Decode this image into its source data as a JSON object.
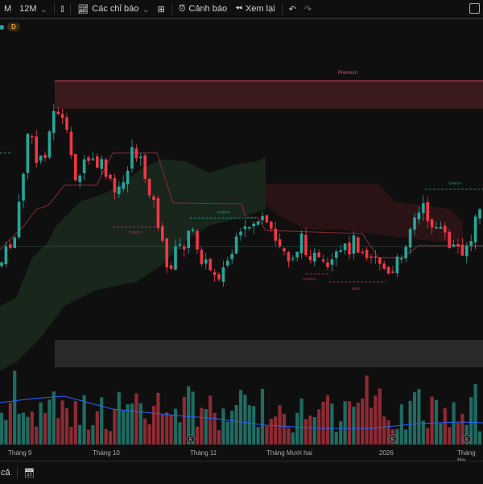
{
  "toolbar": {
    "interval_prev": "M",
    "interval": "12M",
    "indicators_label": "Các chỉ báo",
    "alerts_label": "Cảnh báo",
    "replay_label": "Xem lại"
  },
  "status": {
    "badge": "D"
  },
  "chart": {
    "premium_label": "Premium",
    "labels": [
      "CHoCH",
      "CHoCH",
      "CHoCH",
      "CHoCH",
      "BOS"
    ],
    "colors": {
      "up": "#26a69a",
      "down": "#f23645",
      "premium_zone": "#3b1a1d",
      "discount_zone": "#2a2a2a",
      "volume_ma": "#2962ff"
    },
    "event_markers": [
      "E",
      "E",
      "E"
    ]
  },
  "time_axis": [
    "Tháng 9",
    "Tháng 10",
    "Tháng 11",
    "Tháng Mười hai",
    "2026",
    "Tháng Ha"
  ],
  "bottom_bar": {
    "range_label": "cả"
  }
}
